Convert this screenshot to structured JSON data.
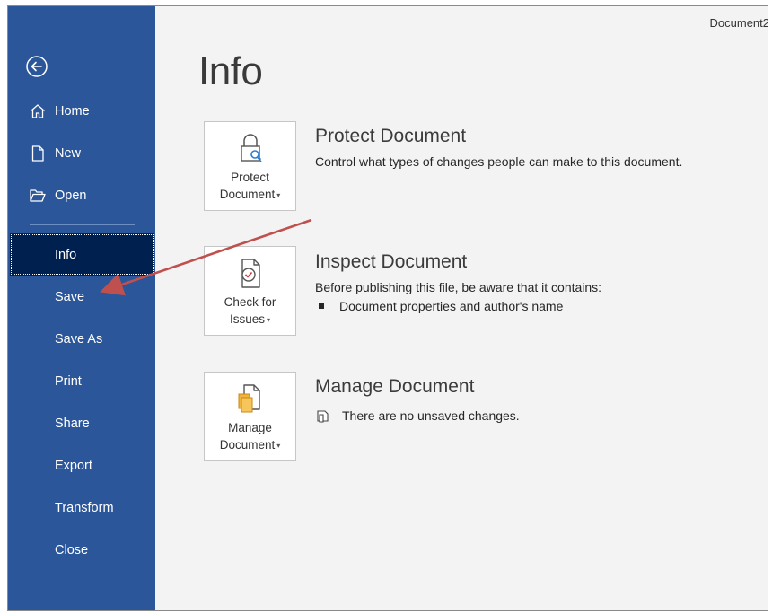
{
  "window": {
    "doc_title": "Document2"
  },
  "sidebar": {
    "back_icon": "back-arrow-circle-icon",
    "items": [
      {
        "label": "Home",
        "icon": "home-icon"
      },
      {
        "label": "New",
        "icon": "new-document-icon"
      },
      {
        "label": "Open",
        "icon": "folder-open-icon"
      },
      {
        "label": "Info",
        "selected": true
      },
      {
        "label": "Save"
      },
      {
        "label": "Save As"
      },
      {
        "label": "Print"
      },
      {
        "label": "Share"
      },
      {
        "label": "Export"
      },
      {
        "label": "Transform"
      },
      {
        "label": "Close"
      }
    ],
    "colors": {
      "background": "#2b579a",
      "selected": "#002050"
    }
  },
  "main": {
    "title": "Info",
    "sections": [
      {
        "tile_label_1": "Protect",
        "tile_label_2": "Document",
        "tile_icon": "lock-key-icon",
        "heading": "Protect Document",
        "description": "Control what types of changes people can make to this document."
      },
      {
        "tile_label_1": "Check for",
        "tile_label_2": "Issues",
        "tile_icon": "inspect-document-icon",
        "heading": "Inspect Document",
        "description": "Before publishing this file, be aware that it contains:",
        "bullets": [
          "Document properties and author's name"
        ]
      },
      {
        "tile_label_1": "Manage",
        "tile_label_2": "Document",
        "tile_icon": "manage-document-icon",
        "heading": "Manage Document",
        "status_icon": "document-versions-icon",
        "status": "There are no unsaved changes."
      }
    ]
  },
  "annotation": {
    "color": "#c0504d",
    "type": "arrow-pointing-to-save"
  }
}
